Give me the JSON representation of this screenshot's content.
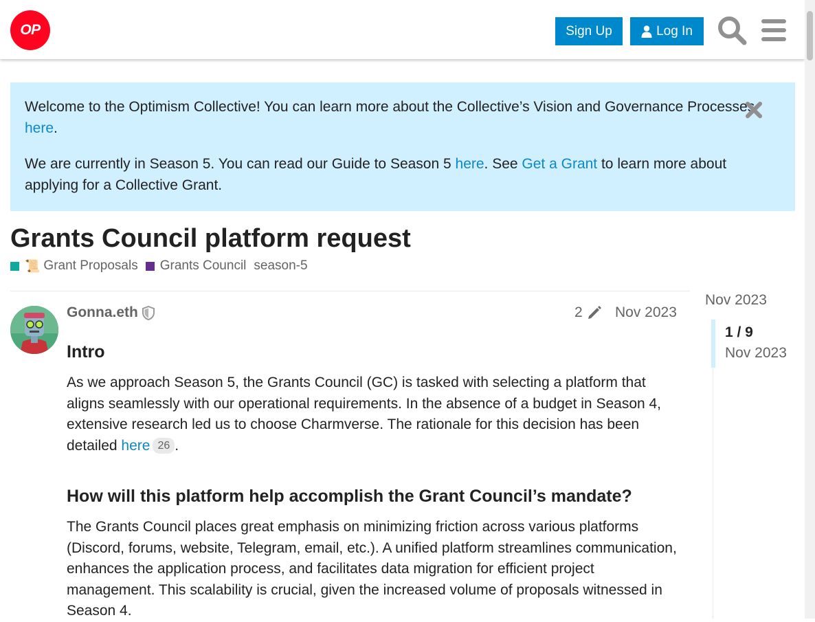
{
  "header": {
    "logo_text": "OP",
    "signup_label": "Sign Up",
    "login_label": "Log In",
    "icons": [
      "search-icon",
      "hamburger-menu-icon",
      "user-icon"
    ]
  },
  "banner": {
    "p1_text": "Welcome to the Optimism Collective! You can learn more about the Collective’s Vision and Governance Processes ",
    "p1_link": "here",
    "p1_end": ".",
    "p2_text": "We are currently in Season 5. You can read our Guide to Season 5 ",
    "p2_link1": "here",
    "p2_mid": ". See ",
    "p2_link2": "Get a Grant",
    "p2_end": " to learn more about applying for a Collective Grant."
  },
  "topic": {
    "title": "Grants Council platform request",
    "categories": [
      {
        "emoji": "📜",
        "label": "Grant Proposals",
        "color": "#12a89d"
      },
      {
        "label": "Grants Council",
        "color": "#652d90"
      }
    ],
    "tags": [
      "season-5"
    ]
  },
  "post": {
    "username": "Gonna.eth",
    "edit_count": "2",
    "date": "Nov 2023",
    "intro_heading": "Intro",
    "intro_text": "As we approach Season 5, the Grants Council (GC) is tasked with selecting a platform that aligns seamlessly with our operational requirements. In the absence of a budget in Season 4, extensive research led us to choose Charmverse. The rationale for this decision has been detailed ",
    "intro_link": "here",
    "intro_link_clicks": "26",
    "intro_end": ".",
    "how_heading": "How will this platform help accomplish the Grant Council’s mandate?",
    "how_text": "The Grants Council places great emphasis on minimizing friction across various platforms (Discord, forums, website, Telegram, email, etc.). A unified platform streamlines communication, enhances the application process, and facilitates data migration for efficient project management. This scalability is crucial, given the increased volume of proposals witnessed in Season 4."
  },
  "timeline": {
    "start_date": "Nov 2023",
    "position": "1 / 9",
    "current_date": "Nov 2023"
  },
  "colors": {
    "accent": "#0088cc",
    "link": "#0e87c9",
    "brand": "#ff0420",
    "banner_bg": "#d1f0ff"
  }
}
